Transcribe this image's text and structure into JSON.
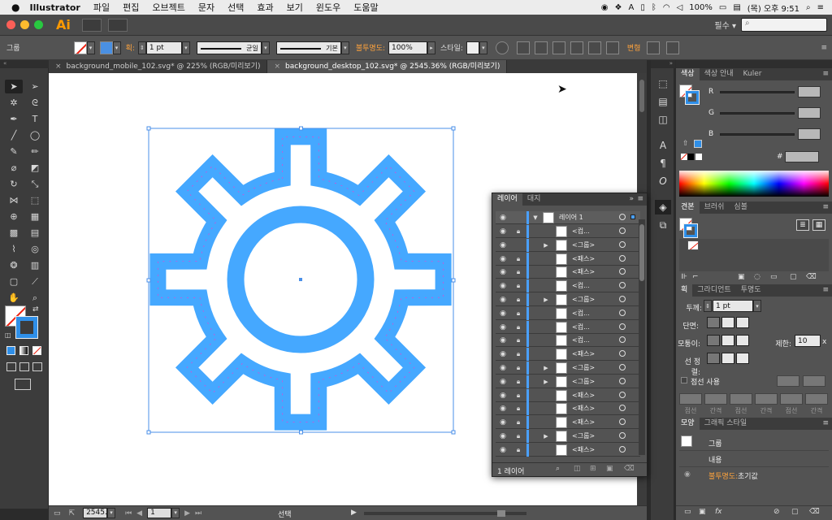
{
  "menubar": {
    "app_name": "Illustrator",
    "items": [
      "파일",
      "편집",
      "오브젝트",
      "문자",
      "선택",
      "효과",
      "보기",
      "윈도우",
      "도움말"
    ],
    "battery": "100%",
    "clock": "(목) 오후 9:51"
  },
  "appbar": {
    "logo": "Ai",
    "workspace": "필수",
    "workspace_arrow": "▾",
    "search_placeholder": "⌕"
  },
  "control_bar": {
    "selection_label": "그룹",
    "stroke_label": "획:",
    "stroke_value": "1 pt",
    "stroke_profile": "균일",
    "brush": "기본",
    "opacity_label": "불투명도:",
    "opacity_value": "100%",
    "style_label": "스타일:",
    "transform_label": "변형"
  },
  "tabs": [
    {
      "label": "background_mobile_102.svg* @ 225% (RGB/미리보기)"
    },
    {
      "label": "background_desktop_102.svg* @ 2545.36% (RGB/미리보기)"
    }
  ],
  "status": {
    "zoom": "2545.3",
    "artboard": "1",
    "mode": "선택"
  },
  "colors": {
    "gear": "#45a8ff",
    "gear_inner_guide": "#ff33cc",
    "selection": "#4a8fe8",
    "fill_swatch": "#2f8fe8"
  },
  "color_panel": {
    "tabs": [
      "색상",
      "색상 안내",
      "Kuler"
    ],
    "r_label": "R",
    "g_label": "G",
    "b_label": "B",
    "hex_label": "#"
  },
  "swatches_panel": {
    "tabs": [
      "견본",
      "브러쉬",
      "심볼"
    ]
  },
  "stroke_panel": {
    "tabs": [
      "획",
      "그라디언트",
      "투명도"
    ],
    "weight_label": "두께:",
    "weight_value": "1 pt",
    "cap_label": "단면:",
    "corner_label": "모퉁이:",
    "limit_label": "제한:",
    "limit_value": "10",
    "limit_suffix": "x",
    "align_label": "선 정렬:",
    "dashed_label": "점선 사용",
    "dash_captions": [
      "점선",
      "간격",
      "점선",
      "간격",
      "점선",
      "간격"
    ]
  },
  "appearance_panel": {
    "tabs": [
      "모양",
      "그래픽 스타일"
    ],
    "group_label": "그룹",
    "contents_label": "내용",
    "opacity_label": "불투명도:",
    "opacity_value": "초기값"
  },
  "layers_panel": {
    "tabs": [
      "레이어",
      "대지"
    ],
    "layer_name": "레이어 1",
    "footer": "1 레이어",
    "rows": [
      {
        "name": "<컴...",
        "locked": true,
        "expandable": false
      },
      {
        "name": "<그룹>",
        "locked": false,
        "expandable": true
      },
      {
        "name": "<패스>",
        "locked": true,
        "expandable": false
      },
      {
        "name": "<패스>",
        "locked": true,
        "expandable": false
      },
      {
        "name": "<컴...",
        "locked": true,
        "expandable": false
      },
      {
        "name": "<그룹>",
        "locked": true,
        "expandable": true
      },
      {
        "name": "<컴...",
        "locked": true,
        "expandable": false
      },
      {
        "name": "<컴...",
        "locked": true,
        "expandable": false
      },
      {
        "name": "<컴...",
        "locked": true,
        "expandable": false
      },
      {
        "name": "<패스>",
        "locked": true,
        "expandable": false
      },
      {
        "name": "<그룹>",
        "locked": true,
        "expandable": true
      },
      {
        "name": "<그룹>",
        "locked": true,
        "expandable": true
      },
      {
        "name": "<패스>",
        "locked": true,
        "expandable": false
      },
      {
        "name": "<패스>",
        "locked": true,
        "expandable": false
      },
      {
        "name": "<패스>",
        "locked": true,
        "expandable": false
      },
      {
        "name": "<그룹>",
        "locked": true,
        "expandable": true
      },
      {
        "name": "<패스>",
        "locked": true,
        "expandable": false
      }
    ]
  }
}
